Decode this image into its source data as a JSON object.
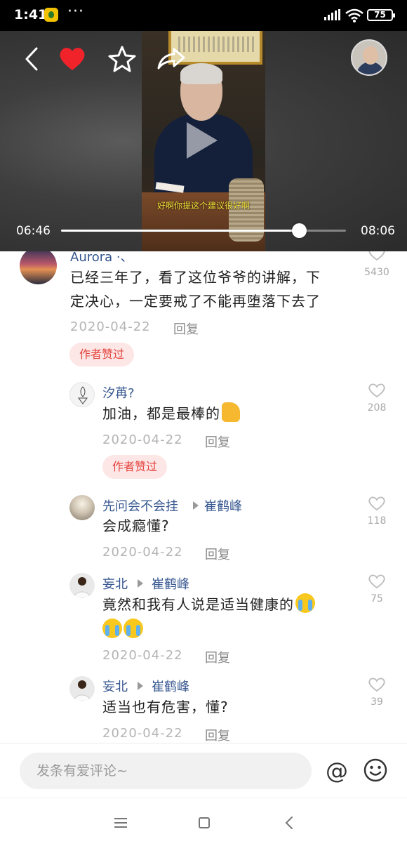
{
  "status_bar": {
    "time": "1:41",
    "dots": "···",
    "battery": "75"
  },
  "video": {
    "subtitle": "好啊你提这个建议很好啊",
    "current_time": "06:46",
    "total_time": "08:06",
    "progress_fraction": 0.835,
    "icons": [
      "back-icon",
      "heart-icon",
      "star-icon",
      "share-icon",
      "play-icon"
    ],
    "liked": true,
    "like_color": "#f0222a"
  },
  "comments": [
    {
      "username": "Aurora ·、",
      "text_lines": [
        "已经三年了，看了这位爷爷的讲解，下",
        "定决心，一定要戒了不能再堕落下去了"
      ],
      "date": "2020-04-22",
      "reply_label": "回复",
      "badge": "作者赞过",
      "likes": "5430"
    },
    {
      "username": "汐苒?",
      "text": "加油，都是最棒的",
      "emoji": "thumbs-up-emoji",
      "date": "2020-04-22",
      "reply_label": "回复",
      "badge": "作者赞过",
      "likes": "208"
    },
    {
      "username": "先问会不会挂",
      "reply_to": "崔鹤峰",
      "text": "会成瘾懂?",
      "date": "2020-04-22",
      "reply_label": "回复",
      "likes": "118"
    },
    {
      "username": "妄北",
      "reply_to": "崔鹤峰",
      "text": "竟然和我有人说是适当健康的",
      "emoji": "loudly-crying-emoji",
      "date": "2020-04-22",
      "reply_label": "回复",
      "likes": "75"
    },
    {
      "username": "妄北",
      "reply_to": "崔鹤峰",
      "text": "适当也有危害，懂?",
      "date": "2020-04-22",
      "reply_label": "回复",
      "likes": "39"
    }
  ],
  "input_bar": {
    "placeholder": "发条有爱评论~",
    "at_symbol": "@"
  },
  "nav_bar": {
    "icons": [
      "menu-icon",
      "home-icon",
      "back-nav-icon"
    ]
  }
}
